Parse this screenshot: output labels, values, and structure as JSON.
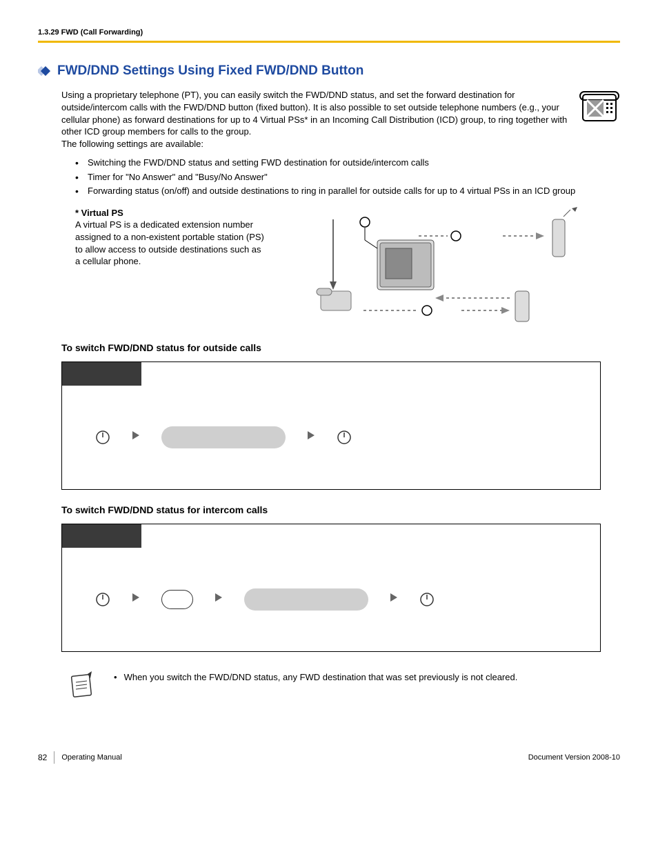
{
  "header": {
    "breadcrumb": "1.3.29 FWD (Call Forwarding)"
  },
  "section": {
    "title": "FWD/DND Settings Using Fixed FWD/DND Button",
    "intro": "Using a proprietary telephone (PT), you can easily switch the FWD/DND status, and set the forward destination for outside/intercom calls with the FWD/DND button (fixed button). It is also possible to set outside telephone numbers (e.g., your cellular phone) as forward destinations for up to 4 Virtual PSs* in an Incoming Call Distribution (ICD) group, to ring together with other ICD group members for calls to the group.",
    "intro_line2": "The following settings are available:",
    "bullets": [
      "Switching the FWD/DND status and setting FWD destination for outside/intercom calls",
      "Timer for \"No Answer\" and \"Busy/No Answer\"",
      "Forwarding status (on/off) and outside destinations to ring in parallel for outside calls for up to 4 virtual PSs in an ICD group"
    ],
    "virtual_ps": {
      "label": "* Virtual PS",
      "body": "A virtual PS is a dedicated extension number assigned to a non-existent portable station (PS) to allow access to outside destinations such as a cellular phone."
    }
  },
  "procedures": {
    "p1": {
      "heading": "To switch FWD/DND status for outside calls"
    },
    "p2": {
      "heading": "To switch FWD/DND status for intercom calls"
    }
  },
  "note": {
    "text": "When you switch the FWD/DND status, any FWD destination that was set previously is not cleared."
  },
  "footer": {
    "page": "82",
    "manual": "Operating Manual",
    "version": "Document Version  2008-10"
  }
}
